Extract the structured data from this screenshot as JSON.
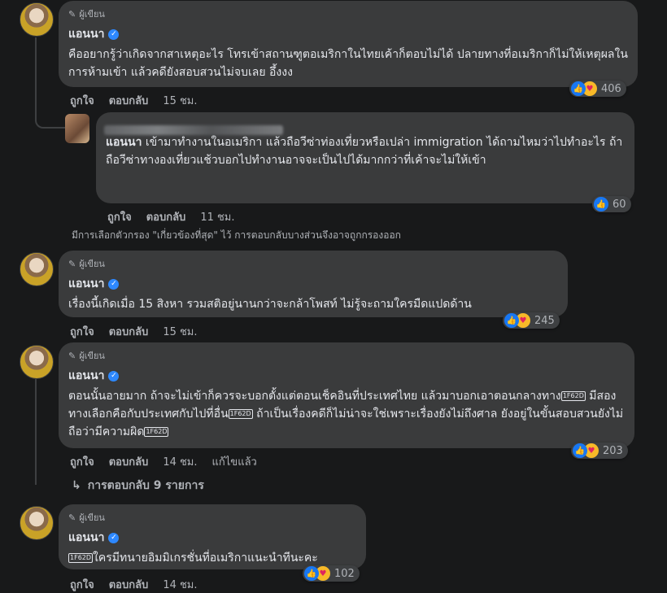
{
  "author_badge": "ผู้เขียน",
  "action_like": "ถูกใจ",
  "action_reply": "ตอบกลับ",
  "comments": [
    {
      "name": "แอนนา",
      "text": "คืออยากรู้ว่าเกิดจากสาเหตุอะไร โทรเข้าสถานฑูตอเมริกาในไทยเค้าก็ตอบไม่ได้ ปลายทางที่อเมริกาก็ไม่ให้เหตุผลในการห้ามเข้า แล้วคดียังสอบสวนไม่จบเลย อึ้งงง",
      "time": "15 ชม.",
      "reactions": "406"
    },
    {
      "name": "แอนนา",
      "text": "เรื่องนี้เกิดเมื่อ 15 สิงหา รวมสติอยู่นานกว่าจะกล้าโพสท์ ไม่รู้จะถามใครมืดแปดด้าน",
      "time": "15 ชม.",
      "reactions": "245"
    },
    {
      "name": "แอนนา",
      "text_parts": [
        "ตอนนั้นอายมาก ถ้าจะไม่เข้าก็ควรจะบอกตั้งแต่ตอนเช็คอินที่ประเทศไทย แล้วมาบอกเอาตอนกลางทาง",
        " มีสองทางเลือกคือกับประเทศกับไปที่อื่น",
        " ถ้าเป็นเรื่องคดีก็ไม่น่าจะใช่เพราะเรื่องยังไม่ถึงศาล ยังอยู่ในขั้นสอบสวนยังไม่ถือว่ามีความผิด"
      ],
      "emoji_code": "1F62D",
      "time": "14 ชม.",
      "edited": "แก้ไขแล้ว",
      "reactions": "203"
    },
    {
      "name": "แอนนา",
      "text_parts": [
        "",
        "ใครมีทนายอิมมิเกรชั่นที่อเมริกาแนะนำทีนะคะ"
      ],
      "emoji_code": "1F62D",
      "time": "14 ชม.",
      "reactions": "102"
    }
  ],
  "reply": {
    "mention": "แอนนา",
    "text": " เข้ามาทำงานในอเมริกา แล้วถือวีซ่าท่องเที่ยวหรือเปล่า immigration ได้ถามไหมว่าไปทำอะไร ถ้าถือวีซ่าทางองเที่ยวแช้วบอกไปทำงานอาจจะเป็นไปได้มากกว่าที่เค้าจะไม่ให้เข้า",
    "time": "11 ชม.",
    "reactions": "60"
  },
  "filter_note": "มีการเลือกตัวกรอง \"เกี่ยวข้องที่สุด\" ไว้ การตอบกลับบางส่วนจึงอาจถูกกรองออก",
  "more_replies": "การตอบกลับ 9 รายการ",
  "colors": {
    "background": "#18191a",
    "bubble": "#3a3b3c",
    "like": "#1877f2",
    "verified": "#2d88ff"
  },
  "icons": [
    "pen-icon",
    "verified-icon",
    "like-reaction-icon",
    "care-reaction-icon",
    "reply-arrow-icon"
  ]
}
